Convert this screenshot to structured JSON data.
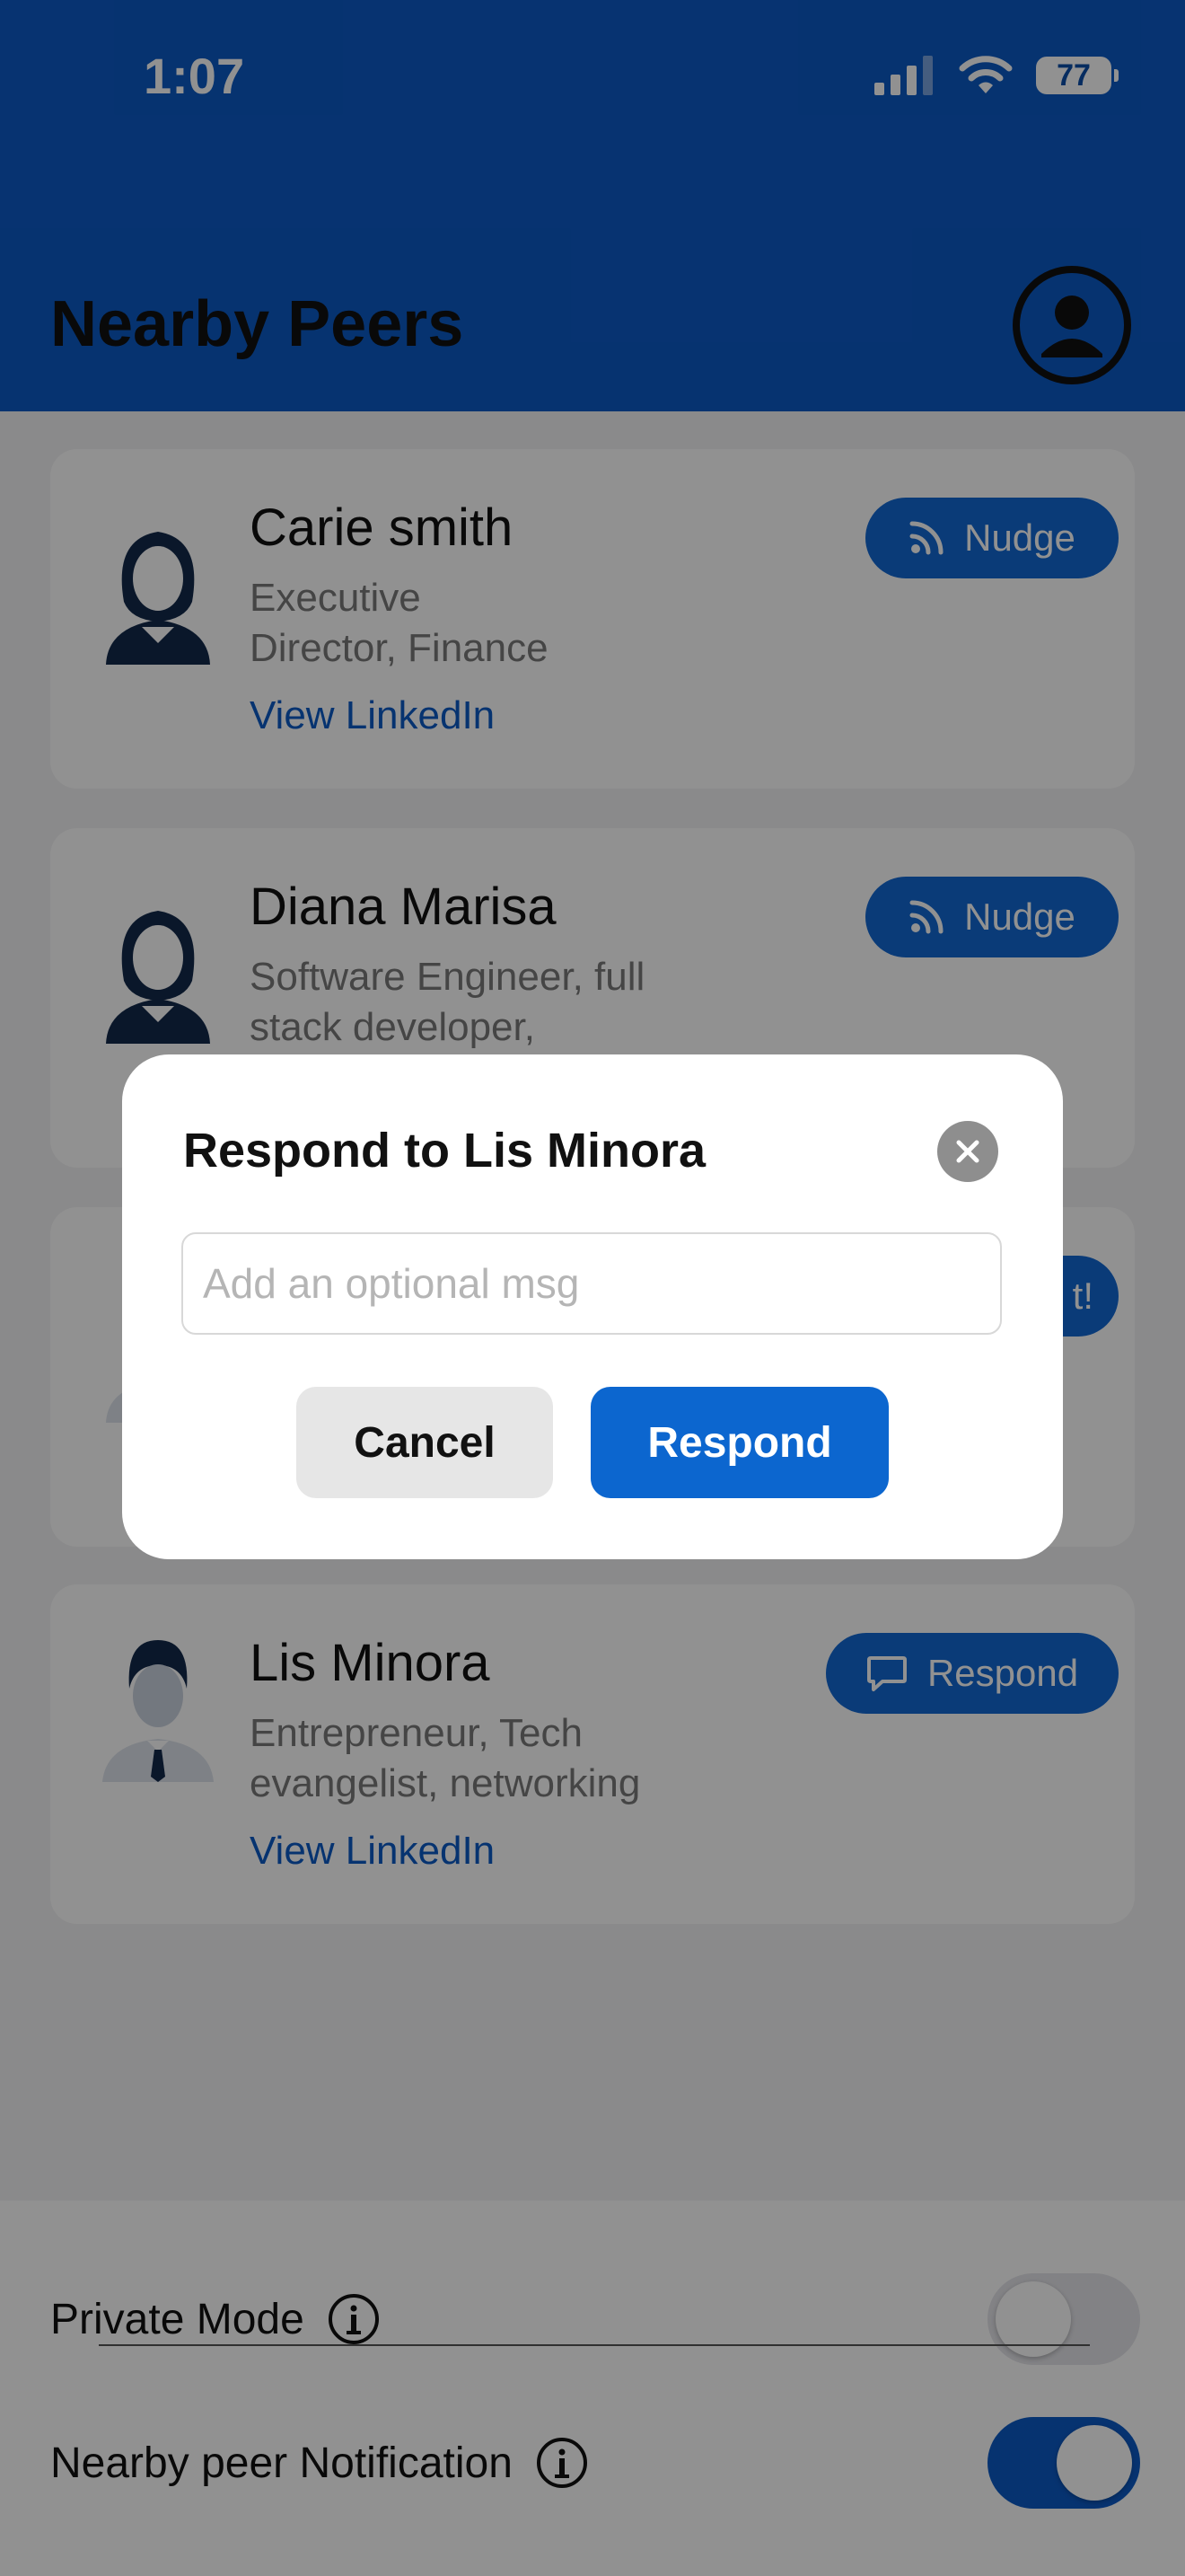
{
  "status_bar": {
    "time": "1:07",
    "battery": "77"
  },
  "header": {
    "title": "Nearby Peers"
  },
  "peers": [
    {
      "name": "Carie smith",
      "role_line1": "Executive",
      "role_line2": "Director, Finance",
      "link": "View LinkedIn",
      "action": "Nudge"
    },
    {
      "name": "Diana Marisa",
      "role_line1": "Software Engineer, full",
      "role_line2": "stack developer,",
      "link": "",
      "action": "Nudge"
    },
    {
      "name": "",
      "role_line1": "",
      "role_line2": "",
      "link": "",
      "action": "t!"
    },
    {
      "name": "Lis Minora",
      "role_line1": "Entrepreneur, Tech",
      "role_line2": "evangelist, networking",
      "link": "View LinkedIn",
      "action": "Respond"
    }
  ],
  "settings": {
    "private_mode": {
      "label": "Private Mode",
      "enabled": false
    },
    "notification": {
      "label": "Nearby peer Notification",
      "enabled": true
    }
  },
  "modal": {
    "title": "Respond to Lis Minora",
    "input_placeholder": "Add an optional msg",
    "input_value": "",
    "cancel_label": "Cancel",
    "respond_label": "Respond"
  },
  "colors": {
    "primary": "#0c5ac6",
    "button_blue": "#1268d4",
    "link_blue": "#0c5ac6",
    "toggle_on": "#0c5ac6",
    "toggle_off": "#e5e5ea"
  }
}
